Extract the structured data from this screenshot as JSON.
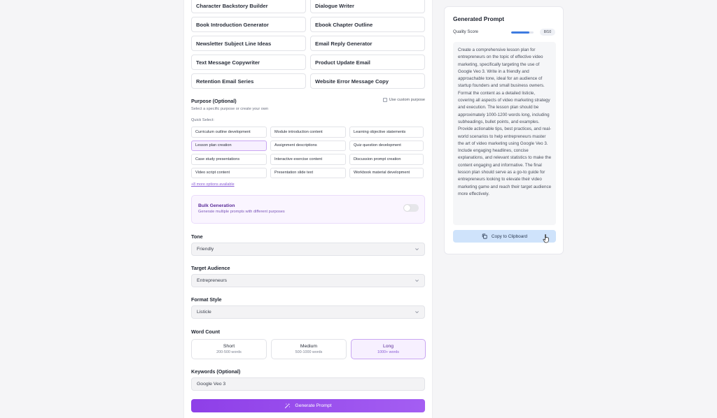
{
  "templates": [
    {
      "left": "Character Backstory Builder",
      "right": "Dialogue Writer"
    },
    {
      "left": "Book Introduction Generator",
      "right": "Ebook Chapter Outline"
    },
    {
      "left": "Newsletter Subject Line Ideas",
      "right": "Email Reply Generator"
    },
    {
      "left": "Text Message Copywriter",
      "right": "Product Update Email"
    },
    {
      "left": "Retention Email Series",
      "right": "Website Error Message Copy"
    }
  ],
  "purpose": {
    "title": "Purpose (Optional)",
    "subtitle": "Select a specific purpose or create your own",
    "custom_label": "Use custom purpose",
    "quick_select_label": "Quick Select:",
    "options": [
      "Curriculum outline development",
      "Module introduction content",
      "Learning objective statements",
      "Lesson plan creation",
      "Assignment descriptions",
      "Quiz question development",
      "Case study presentations",
      "Interactive exercise content",
      "Discussion prompt creation",
      "Video script content",
      "Presentation slide text",
      "Workbook material development"
    ],
    "selected": "Lesson plan creation",
    "more_link": "+8 more options available"
  },
  "bulk": {
    "title": "Bulk Generation",
    "description": "Generate multiple prompts with different purposes",
    "enabled": false
  },
  "tone": {
    "label": "Tone",
    "value": "Friendly"
  },
  "audience": {
    "label": "Target Audience",
    "value": "Entrepreneurs"
  },
  "format": {
    "label": "Format Style",
    "value": "Listicle"
  },
  "word_count": {
    "label": "Word Count",
    "options": [
      {
        "name": "Short",
        "range": "200-500 words"
      },
      {
        "name": "Medium",
        "range": "500-1000 words"
      },
      {
        "name": "Long",
        "range": "1000+ words"
      }
    ],
    "selected": "Long"
  },
  "keywords": {
    "label": "Keywords (Optional)",
    "value": "Google Veo 3"
  },
  "generate_label": "Generate Prompt",
  "generated": {
    "title": "Generated Prompt",
    "quality_label": "Quality Score",
    "quality_score": "8/10",
    "quality_fraction": 0.8,
    "prompt_text": "Create a comprehensive lesson plan for entrepreneurs on the topic of effective video marketing, specifically targeting the use of Google Veo 3. Write in a friendly and approachable tone, ideal for an audience of startup founders and small business owners. Format the content as a detailed listicle, covering all aspects of video marketing strategy and execution. The lesson plan should be approximately 1000-1200 words long, including subheadings, bullet points, and examples. Provide actionable tips, best practices, and real-world scenarios to help entrepreneurs master the art of video marketing using Google Veo 3. Include engaging headlines, concise explanations, and relevant statistics to make the content engaging and informative. The final lesson plan should serve as a go-to guide for entrepreneurs looking to elevate their video marketing game and reach their target audience more effectively.",
    "copy_label": "Copy to Clipboard"
  },
  "colors": {
    "accent": "#8e3fe8",
    "accent_light": "#f7f0ff",
    "copy_button": "#cfe3fb",
    "quality_bar": "#3e7be0"
  },
  "icons": {
    "generate": "sparkle-wand-icon",
    "copy": "copy-icon",
    "select": "chevron-down-icon",
    "cursor": "hand-pointer-icon"
  }
}
